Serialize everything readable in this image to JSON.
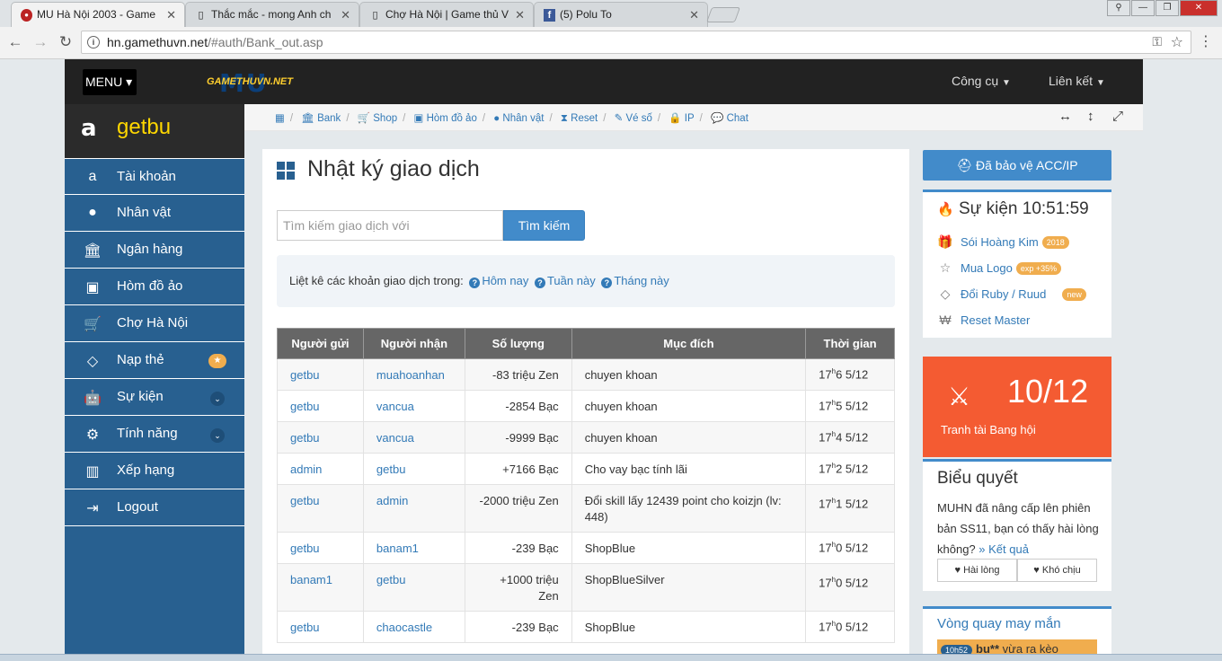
{
  "browser": {
    "tabs": [
      {
        "title": "MU Hà Nội 2003 - Game",
        "icon": "mu-favicon"
      },
      {
        "title": "Thắc mắc - mong Anh ch",
        "icon": "doc-icon"
      },
      {
        "title": "Chợ Hà Nội | Game thủ V",
        "icon": "doc-icon"
      },
      {
        "title": "(5) Polu To",
        "icon": "facebook-icon"
      }
    ],
    "url_host": "hn.gamethuvn.net",
    "url_path": "/#auth/Bank_out.asp"
  },
  "topnav": {
    "menu_label": "MENU",
    "logo_text": "GAMETHUVN.NET",
    "logo_mark": "MU",
    "tools": "Công cụ",
    "links": "Liên kết"
  },
  "sidebar": {
    "username": "getbu",
    "items": [
      {
        "label": "Tài khoản",
        "icon": "amazon-icon"
      },
      {
        "label": "Nhân vật",
        "icon": "user-icon"
      },
      {
        "label": "Ngân hàng",
        "icon": "bank-icon"
      },
      {
        "label": "Hòm đồ ảo",
        "icon": "briefcase-icon"
      },
      {
        "label": "Chợ Hà Nội",
        "icon": "cart-icon"
      },
      {
        "label": "Nạp thẻ",
        "icon": "diamond-icon",
        "badge": "★"
      },
      {
        "label": "Sự kiện",
        "icon": "android-icon"
      },
      {
        "label": "Tính năng",
        "icon": "gears-icon"
      },
      {
        "label": "Xếp hạng",
        "icon": "bar-chart-icon"
      },
      {
        "label": "Logout",
        "icon": "sign-out-icon"
      }
    ]
  },
  "breadcrumb": [
    "Bank",
    "Shop",
    "Hòm đồ ảo",
    "Nhân vật",
    "Reset",
    "Vé số",
    "IP",
    "Chat"
  ],
  "main": {
    "title": "Nhật ký giao dịch",
    "search_placeholder": "Tìm kiếm giao dịch với",
    "search_button": "Tìm kiếm",
    "info_text": "Liệt kê các khoản giao dịch trong:",
    "filters": [
      "Hôm nay",
      "Tuần này",
      "Tháng này"
    ],
    "columns": [
      "Người gửi",
      "Người nhận",
      "Số lượng",
      "Mục đích",
      "Thời gian"
    ],
    "rows": [
      {
        "from": "getbu",
        "to": "muahoanhan",
        "amount": "-83  triệu Zen",
        "purpose": "chuyen khoan",
        "hour": "17",
        "time": "6 5/12"
      },
      {
        "from": "getbu",
        "to": "vancua",
        "amount": "-2854  Bạc",
        "purpose": "chuyen khoan",
        "hour": "17",
        "time": "5 5/12"
      },
      {
        "from": "getbu",
        "to": "vancua",
        "amount": "-9999  Bạc",
        "purpose": "chuyen khoan",
        "hour": "17",
        "time": "4 5/12"
      },
      {
        "from": "admin",
        "to": "getbu",
        "amount": "+7166  Bạc",
        "purpose": "Cho vay bạc tính lãi",
        "hour": "17",
        "time": "2 5/12"
      },
      {
        "from": "getbu",
        "to": "admin",
        "amount": "-2000  triệu Zen",
        "purpose": "Đổi skill lấy 12439 point cho koizjn (lv: 448)",
        "hour": "17",
        "time": "1 5/12"
      },
      {
        "from": "getbu",
        "to": "banam1",
        "amount": "-239  Bạc",
        "purpose": "ShopBlue",
        "hour": "17",
        "time": "0 5/12"
      },
      {
        "from": "banam1",
        "to": "getbu",
        "amount": "+1000  triệu Zen",
        "purpose": "ShopBlueSilver",
        "hour": "17",
        "time": "0 5/12"
      },
      {
        "from": "getbu",
        "to": "chaocastle",
        "amount": "-239  Bạc",
        "purpose": "ShopBlue",
        "hour": "17",
        "time": "0 5/12"
      }
    ],
    "hour_unit": "h"
  },
  "right": {
    "protect_button": "Đã bảo vệ ACC/IP",
    "event_title": "Sự kiện 10:51:59",
    "events": [
      {
        "label": "Sói Hoàng Kim",
        "tag": "2018",
        "icon": "gift-icon"
      },
      {
        "label": "Mua Logo",
        "tag": "exp +35%",
        "icon": "star-icon"
      },
      {
        "label": "Đổi Ruby / Ruud",
        "tag": "new",
        "icon": "diamond-icon"
      },
      {
        "label": "Reset Master",
        "tag": "",
        "icon": "won-icon"
      }
    ],
    "clan_date": "10/12",
    "clan_caption": "Tranh tài Bang hội",
    "vote_title": "Biểu quyết",
    "vote_question": "MUHN đã nâng cấp lên phiên bản SS11, bạn có thấy hài lòng không?",
    "vote_result": "» Kết quả",
    "vote_yes": "Hài lòng",
    "vote_no": "Khó chịu",
    "luck_title": "Vòng quay may mắn",
    "luck_time": "10h52",
    "luck_user": "bu**",
    "luck_text": "vừa ra kèo"
  },
  "colors": {
    "sidebar": "#286090",
    "accent": "#428bca",
    "clan": "#f45b32",
    "username": "#ffd700"
  }
}
